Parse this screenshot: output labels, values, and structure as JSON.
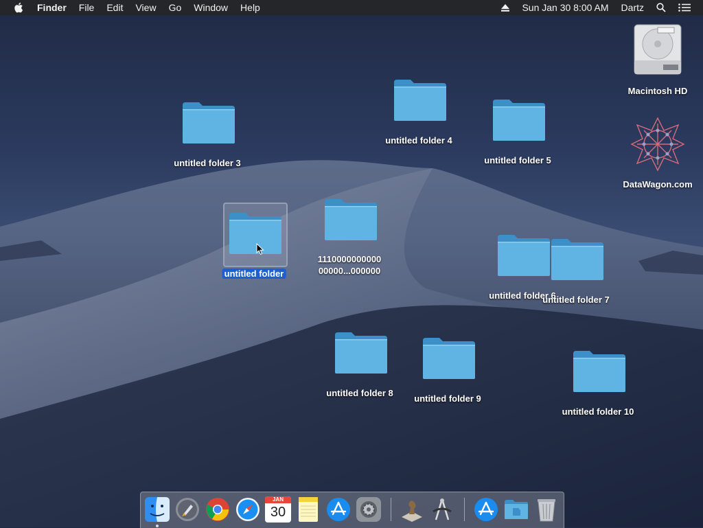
{
  "menubar": {
    "app": "Finder",
    "items": [
      "File",
      "Edit",
      "View",
      "Go",
      "Window",
      "Help"
    ],
    "datetime": "Sun Jan 30  8:00 AM",
    "user": "Dartz"
  },
  "desktop": {
    "drives": {
      "macintosh_hd": "Macintosh HD",
      "datawagon": "DataWagon.com"
    },
    "folders": {
      "f3": "untitled folder 3",
      "f4": "untitled folder 4",
      "f5": "untitled folder 5",
      "selected": "untitled folder",
      "long_line1": "1110000000000",
      "long_line2": "00000...000000",
      "f6": "untitled folder 6",
      "f7": "untitled folder 7",
      "f8": "untitled folder 8",
      "f9": "untitled folder 9",
      "f10": "untitled folder 10"
    }
  },
  "dock": {
    "apps": [
      "finder-icon",
      "launchpad-icon",
      "chrome-icon",
      "safari-icon",
      "calendar-icon",
      "notes-icon",
      "app-store-icon",
      "system-preferences-icon",
      "chess-icon",
      "instruments-icon",
      "app-store-downloads-icon",
      "documents-folder-icon",
      "trash-icon"
    ],
    "calendar_month": "JAN",
    "calendar_day": "30"
  },
  "colors": {
    "selection": "#1b5fd1",
    "folder_front": "#5fb4e4",
    "folder_back": "#3d8fc8"
  }
}
